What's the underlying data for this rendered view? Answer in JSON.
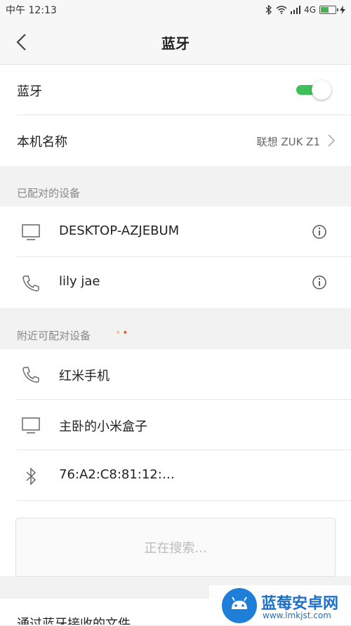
{
  "status_bar": {
    "time": "中午 12:13",
    "network": "4G"
  },
  "header": {
    "title": "蓝牙"
  },
  "bluetooth_row": {
    "label": "蓝牙",
    "enabled": true
  },
  "device_name_row": {
    "label": "本机名称",
    "value": "联想 ZUK Z1"
  },
  "paired_section": {
    "title": "已配对的设备",
    "devices": [
      {
        "name": "DESKTOP-AZJEBUM",
        "icon": "monitor-icon"
      },
      {
        "name": "lily jae",
        "icon": "phone-icon"
      }
    ]
  },
  "available_section": {
    "title": "附近可配对设备",
    "devices": [
      {
        "name": "红米手机",
        "icon": "phone-icon"
      },
      {
        "name": "主卧的小米盒子",
        "icon": "monitor-icon"
      },
      {
        "name": "76:A2:C8:81:12:…",
        "icon": "bluetooth-icon"
      }
    ],
    "searching_label": "正在搜索..."
  },
  "bottom_row": {
    "label": "通过蓝牙接收的文件"
  },
  "watermark": {
    "brand": "蓝莓安卓网",
    "url": "www.lmkjst.com"
  },
  "colors": {
    "toggle_on": "#3cc05a",
    "accent": "#1e7ed8"
  }
}
